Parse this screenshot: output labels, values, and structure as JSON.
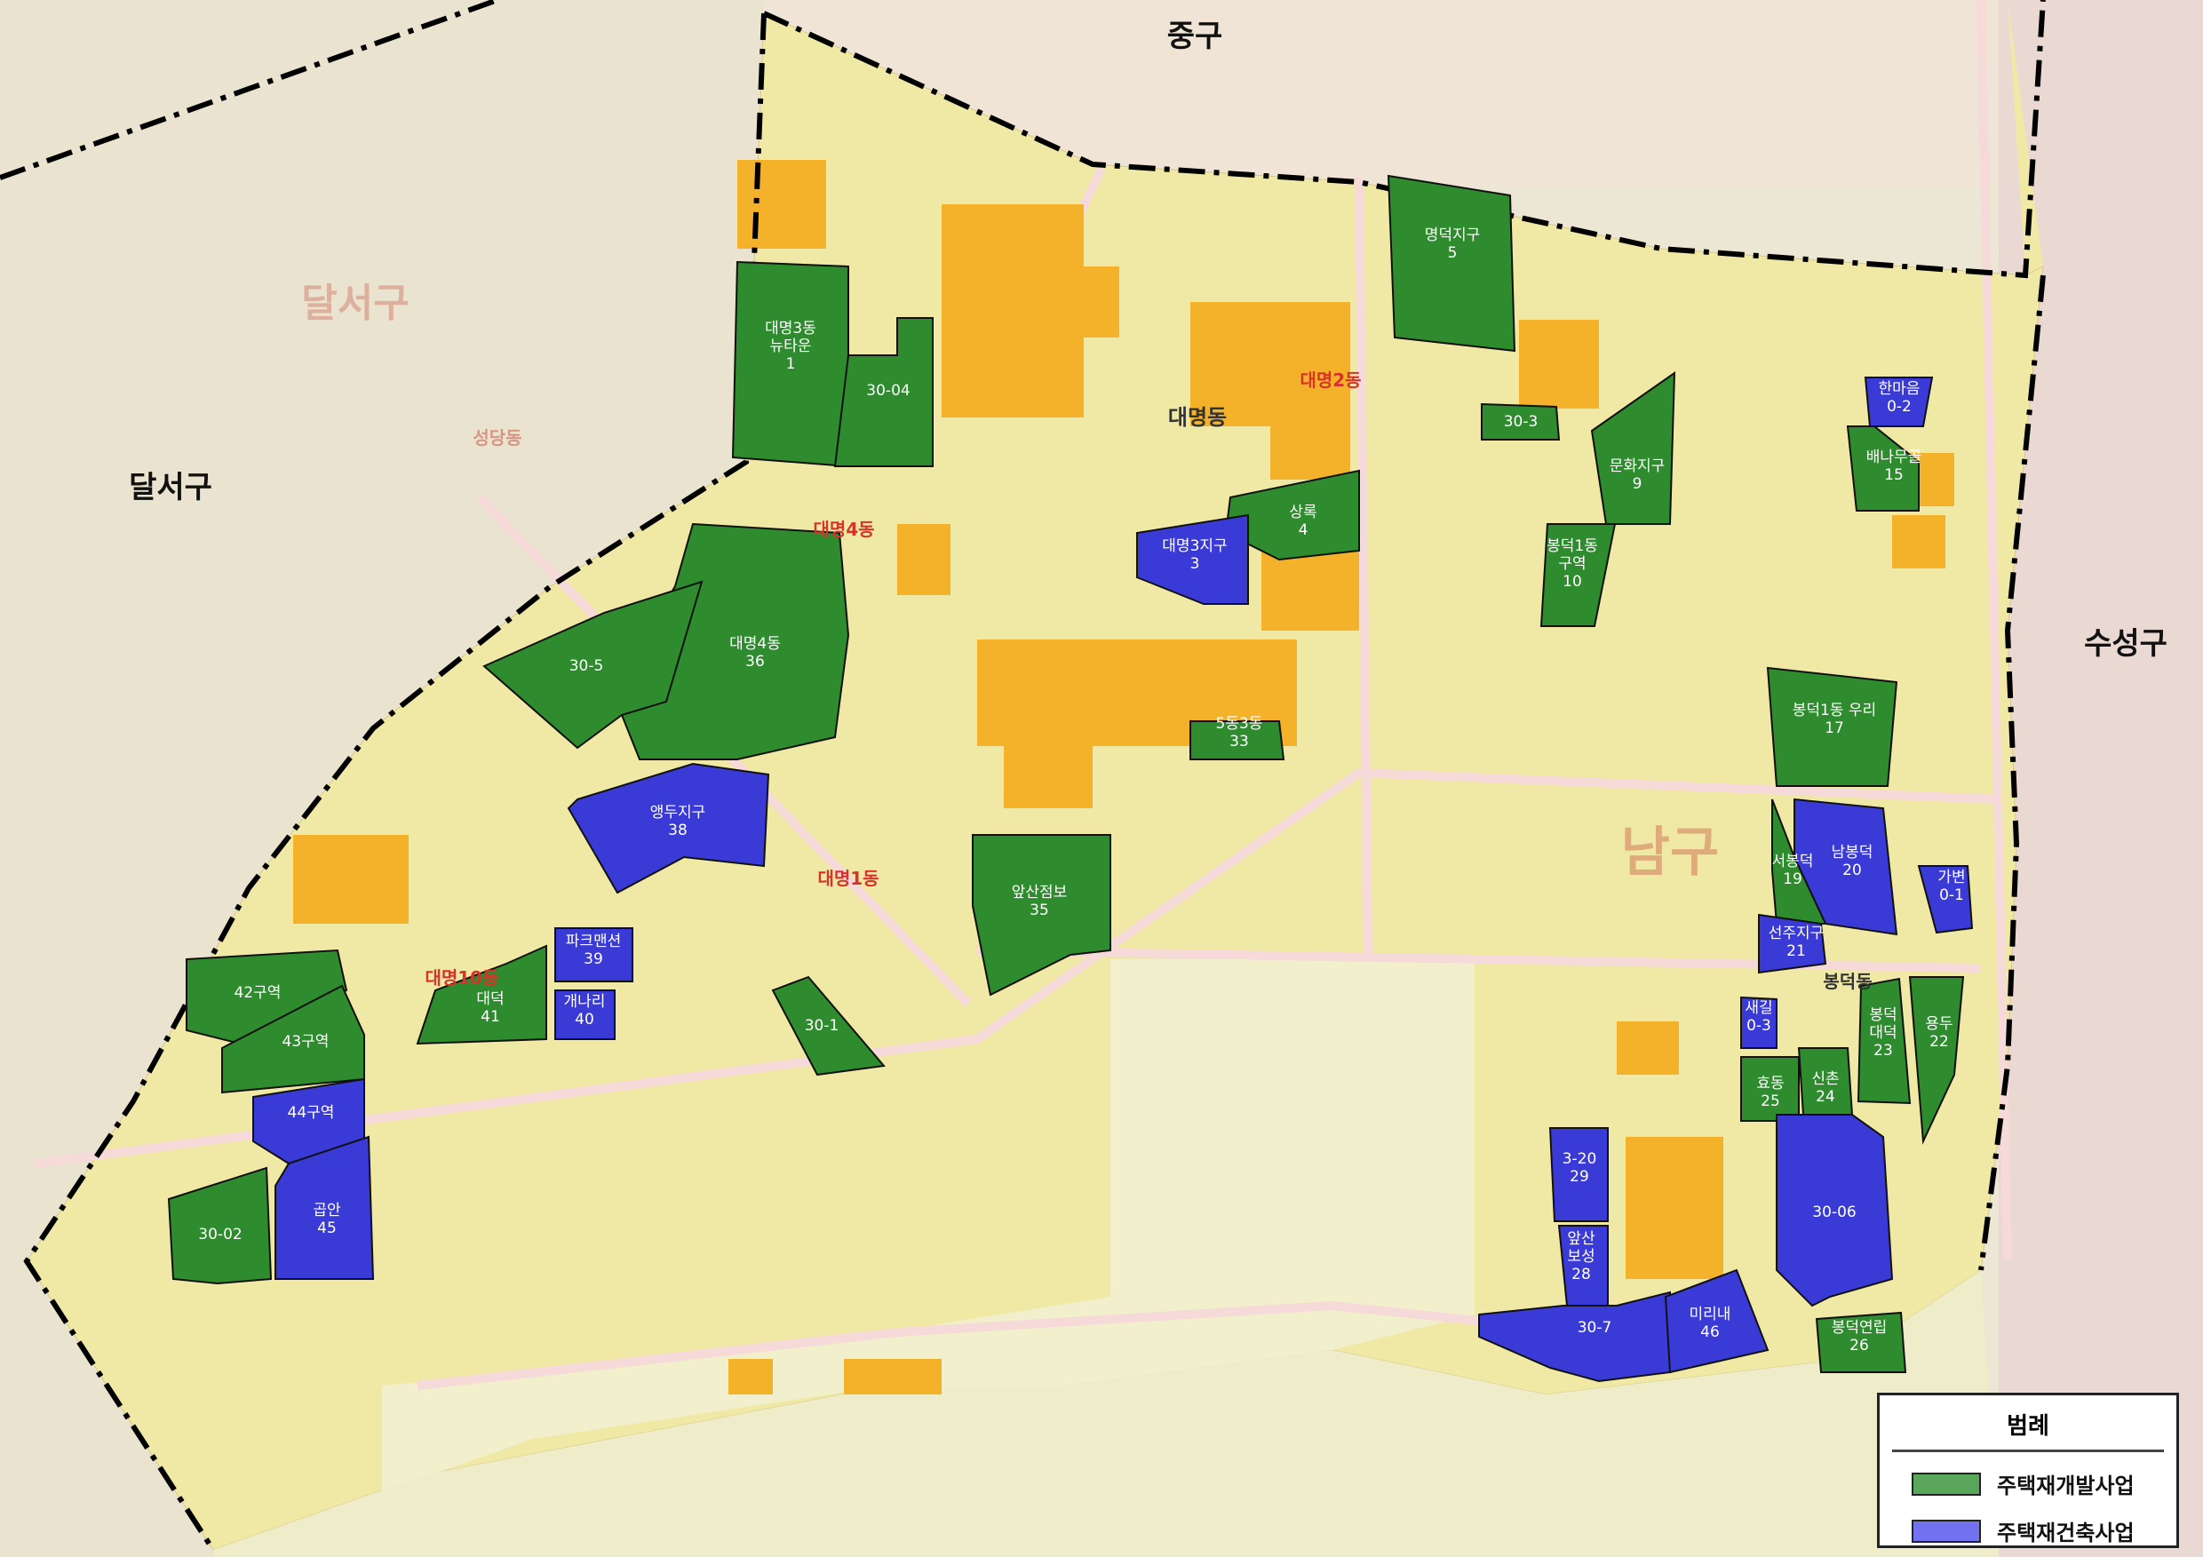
{
  "colors": {
    "redevelopment": "#2e8b2e",
    "reconstruction": "#3a3ad6",
    "school": "#f3b22a",
    "boundary": "#000000",
    "dong_text": "#d8332a"
  },
  "district_labels": [
    "중구",
    "달서구",
    "수성구",
    "남구",
    "달서구"
  ],
  "dong_labels": [
    "대명동",
    "대명4동",
    "대명1동",
    "대명10동",
    "대명2동",
    "봉덕동",
    "성당동"
  ],
  "zones": [
    {
      "type": "redevelopment",
      "name": "대명3동\n뉴타운",
      "number": "1"
    },
    {
      "type": "redevelopment",
      "name": "30-04",
      "number": ""
    },
    {
      "type": "redevelopment",
      "name": "명덕지구",
      "number": "5"
    },
    {
      "type": "redevelopment",
      "name": "30-3",
      "number": ""
    },
    {
      "type": "redevelopment",
      "name": "문화지구",
      "number": "9"
    },
    {
      "type": "redevelopment",
      "name": "봉덕1동\n구역",
      "number": "10"
    },
    {
      "type": "reconstruction",
      "name": "한마음",
      "number": "0-2"
    },
    {
      "type": "redevelopment",
      "name": "배나무골",
      "number": "15"
    },
    {
      "type": "redevelopment",
      "name": "상록",
      "number": "4"
    },
    {
      "type": "reconstruction",
      "name": "대명3지구",
      "number": "3"
    },
    {
      "type": "redevelopment",
      "name": "대명4동",
      "number": "36"
    },
    {
      "type": "redevelopment",
      "name": "30-5",
      "number": ""
    },
    {
      "type": "redevelopment",
      "name": "5동3동",
      "number": "33"
    },
    {
      "type": "reconstruction",
      "name": "앵두지구",
      "number": "38"
    },
    {
      "type": "redevelopment",
      "name": "봉덕1동 우리",
      "number": "17"
    },
    {
      "type": "reconstruction",
      "name": "남봉덕",
      "number": "20"
    },
    {
      "type": "redevelopment",
      "name": "서봉덕",
      "number": "19"
    },
    {
      "type": "reconstruction",
      "name": "가변",
      "number": "0-1"
    },
    {
      "type": "reconstruction",
      "name": "선주지구",
      "number": "21"
    },
    {
      "type": "redevelopment",
      "name": "앞산점보",
      "number": "35"
    },
    {
      "type": "reconstruction",
      "name": "파크맨션",
      "number": "39"
    },
    {
      "type": "reconstruction",
      "name": "개나리",
      "number": "40"
    },
    {
      "type": "redevelopment",
      "name": "대덕",
      "number": "41"
    },
    {
      "type": "redevelopment",
      "name": "42구역",
      "number": ""
    },
    {
      "type": "redevelopment",
      "name": "43구역",
      "number": ""
    },
    {
      "type": "redevelopment",
      "name": "30-1",
      "number": ""
    },
    {
      "type": "reconstruction",
      "name": "새길",
      "number": "0-3"
    },
    {
      "type": "redevelopment",
      "name": "봉덕\n대덕",
      "number": "23"
    },
    {
      "type": "redevelopment",
      "name": "용두",
      "number": "22"
    },
    {
      "type": "redevelopment",
      "name": "효동",
      "number": "25"
    },
    {
      "type": "redevelopment",
      "name": "신촌",
      "number": "24"
    },
    {
      "type": "reconstruction",
      "name": "44구역",
      "number": ""
    },
    {
      "type": "reconstruction",
      "name": "곱안",
      "number": "45"
    },
    {
      "type": "redevelopment",
      "name": "30-02",
      "number": ""
    },
    {
      "type": "reconstruction",
      "name": "3-20",
      "number": "29"
    },
    {
      "type": "reconstruction",
      "name": "앞산\n보성",
      "number": "28"
    },
    {
      "type": "reconstruction",
      "name": "30-06",
      "number": ""
    },
    {
      "type": "reconstruction",
      "name": "30-7",
      "number": ""
    },
    {
      "type": "reconstruction",
      "name": "미리내",
      "number": "46"
    },
    {
      "type": "redevelopment",
      "name": "봉덕연립",
      "number": "26"
    }
  ],
  "legend": {
    "title": "범례",
    "items": [
      {
        "type": "redevelopment",
        "label": "주택재개발사업"
      },
      {
        "type": "reconstruction",
        "label": "주택재건축사업"
      }
    ]
  }
}
